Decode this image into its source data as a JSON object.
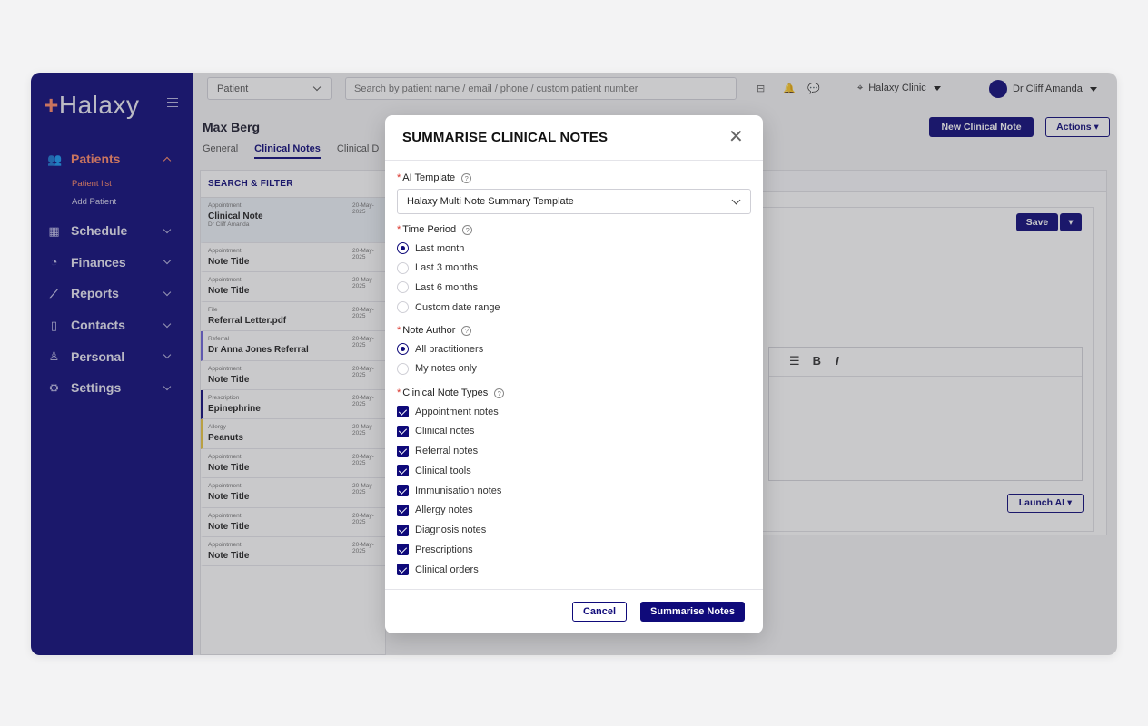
{
  "sidebar": {
    "logo": "Halaxy",
    "nav": [
      {
        "label": "Patients",
        "icon": "users-icon",
        "active": true
      },
      {
        "label": "Schedule",
        "icon": "calendar-icon"
      },
      {
        "label": "Finances",
        "icon": "pie-chart-icon"
      },
      {
        "label": "Reports",
        "icon": "line-chart-icon"
      },
      {
        "label": "Contacts",
        "icon": "address-book-icon"
      },
      {
        "label": "Personal",
        "icon": "person-icon"
      },
      {
        "label": "Settings",
        "icon": "gear-icon"
      }
    ],
    "patients_sub": [
      "Patient list",
      "Add Patient"
    ]
  },
  "topbar": {
    "patient_select": "Patient",
    "search_placeholder": "Search by patient name / email / phone / custom patient number",
    "clinic": "Halaxy Clinic",
    "user": "Dr Cliff Amanda"
  },
  "patient": {
    "name": "Max Berg",
    "tabs": [
      "General",
      "Clinical Notes",
      "Clinical D"
    ],
    "new_note_button": "New Clinical Note",
    "actions_button": "Actions ▾",
    "save_button": "Save",
    "launch_ai_button": "Launch AI ▾"
  },
  "notes_panel": {
    "header": "SEARCH & FILTER",
    "notes": [
      {
        "type": "Appointment",
        "date": "20-May-2025",
        "title": "Clinical Note",
        "sub": "Dr Cliff Amanda"
      },
      {
        "type": "Appointment",
        "date": "20-May-2025",
        "title": "Note Title"
      },
      {
        "type": "Appointment",
        "date": "20-May-2025",
        "title": "Note Title"
      },
      {
        "type": "File",
        "date": "20-May-2025",
        "title": "Referral Letter.pdf"
      },
      {
        "type": "Referral",
        "date": "20-May-2025",
        "title": "Dr Anna Jones Referral"
      },
      {
        "type": "Appointment",
        "date": "20-May-2025",
        "title": "Note Title"
      },
      {
        "type": "Prescription",
        "date": "20-May-2025",
        "title": "Epinephrine"
      },
      {
        "type": "Allergy",
        "date": "20-May-2025",
        "title": "Peanuts"
      },
      {
        "type": "Appointment",
        "date": "20-May-2025",
        "title": "Note Title"
      },
      {
        "type": "Appointment",
        "date": "20-May-2025",
        "title": "Note Title"
      },
      {
        "type": "Appointment",
        "date": "20-May-2025",
        "title": "Note Title"
      },
      {
        "type": "Appointment",
        "date": "20-May-2025",
        "title": "Note Title"
      }
    ]
  },
  "modal": {
    "title": "SUMMARISE CLINICAL NOTES",
    "ai_template_label": "AI Template",
    "ai_template_value": "Halaxy Multi Note Summary Template",
    "time_period_label": "Time Period",
    "time_period_options": [
      "Last month",
      "Last 3 months",
      "Last 6 months",
      "Custom date range"
    ],
    "time_period_selected": "Last month",
    "note_author_label": "Note Author",
    "note_author_options": [
      "All practitioners",
      "My notes only"
    ],
    "note_author_selected": "All practitioners",
    "note_types_label": "Clinical Note Types",
    "note_types": [
      "Appointment notes",
      "Clinical notes",
      "Referral notes",
      "Clinical tools",
      "Immunisation notes",
      "Allergy notes",
      "Diagnosis notes",
      "Prescriptions",
      "Clinical orders"
    ],
    "cancel_button": "Cancel",
    "submit_button": "Summarise Notes"
  },
  "colors": {
    "brand": "#0f0a7a",
    "accent": "#ff8a6a",
    "required": "#d9342b"
  }
}
